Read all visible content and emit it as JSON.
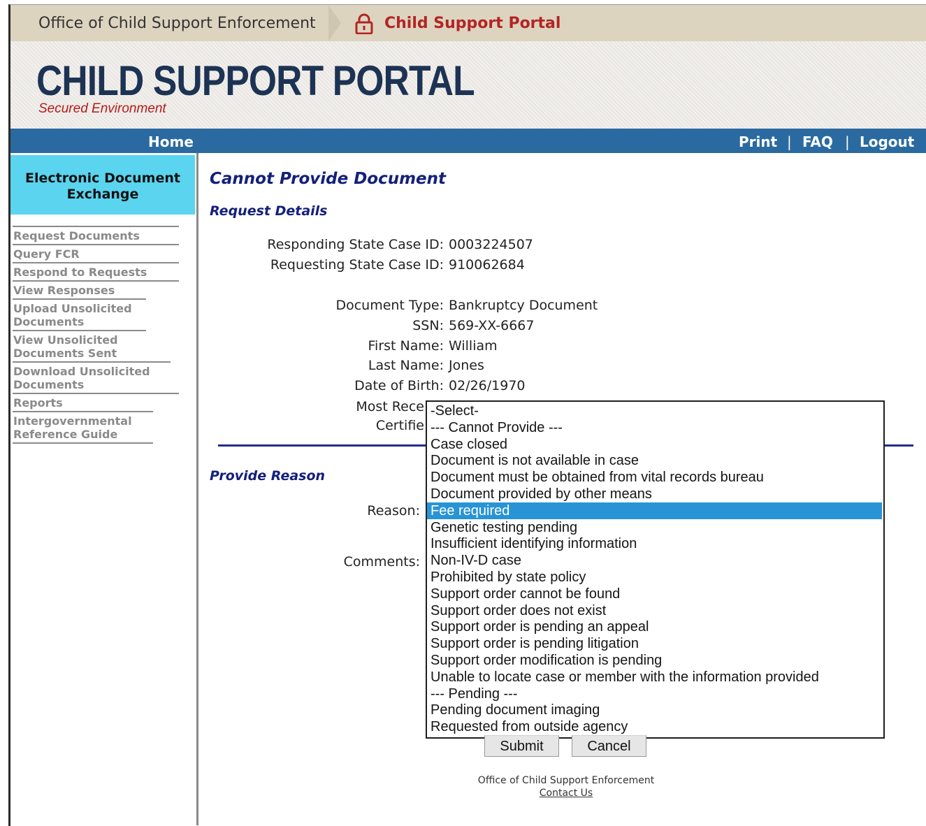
{
  "topbar": {
    "agency": "Office of Child Support Enforcement",
    "portal": "Child Support Portal"
  },
  "banner": {
    "title": "CHILD SUPPORT PORTAL",
    "subtitle": "Secured Environment"
  },
  "nav": {
    "home": "Home",
    "print": "Print",
    "faq": "FAQ",
    "logout": "Logout",
    "separator": "|"
  },
  "sidebar": {
    "header_line1": "Electronic Document",
    "header_line2": "Exchange",
    "items": [
      {
        "label": "Request Documents"
      },
      {
        "label": "Query FCR"
      },
      {
        "label": "Respond to Requests"
      },
      {
        "label": "View Responses"
      },
      {
        "label": "Upload Unsolicited Documents"
      },
      {
        "label": "View Unsolicited Documents Sent"
      },
      {
        "label": "Download Unsolicited Documents"
      },
      {
        "label": "Reports"
      },
      {
        "label": "Intergovernmental Reference Guide"
      }
    ]
  },
  "main": {
    "page_title": "Cannot Provide Document",
    "request_details_heading": "Request Details",
    "responding_case_label": "Responding State Case ID:",
    "responding_case_value": "0003224507",
    "requesting_case_label": "Requesting State Case ID:",
    "requesting_case_value": "910062684",
    "document_type_label": "Document Type:",
    "document_type_value": "Bankruptcy Document",
    "ssn_label": "SSN:",
    "ssn_value": "569-XX-6667",
    "first_name_label": "First Name:",
    "first_name_value": "William",
    "last_name_label": "Last Name:",
    "last_name_value": "Jones",
    "dob_label": "Date of Birth:",
    "dob_value": "02/26/1970",
    "most_recent_label": "Most Rece",
    "certified_label": "Certifie",
    "provide_reason_heading": "Provide Reason",
    "reason_label": "Reason:",
    "comments_label": "Comments:"
  },
  "reason_dropdown": {
    "selected": "Fee required",
    "options": [
      "-Select-",
      "--- Cannot Provide ---",
      "Case closed",
      "Document is not available in case",
      "Document must be obtained from vital records bureau",
      "Document provided by other means",
      "Fee required",
      "Genetic testing pending",
      "Insufficient identifying information",
      "Non-IV-D case",
      "Prohibited by state policy",
      "Support order cannot be found",
      "Support order does not exist",
      "Support order is pending an appeal",
      "Support order is pending litigation",
      "Support order modification is pending",
      "Unable to locate case or member with the information provided",
      "--- Pending ---",
      "Pending document imaging",
      "Requested from outside agency"
    ]
  },
  "actions": {
    "submit": "Submit",
    "cancel": "Cancel"
  },
  "footer": {
    "org": "Office of Child Support Enforcement",
    "contact": "Contact Us"
  },
  "colors": {
    "nav_blue": "#2a6aa0",
    "sidebar_header": "#5ad4ef",
    "heading_blue": "#13207a",
    "portal_red": "#b22525",
    "selected_option": "#2894d6"
  }
}
